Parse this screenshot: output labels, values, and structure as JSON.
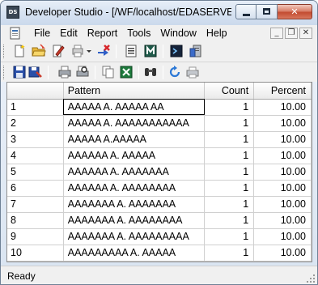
{
  "window": {
    "title": "Developer Studio - [/WF/localhost/EDASERVE:",
    "app_icon_text": "DS"
  },
  "menubar": {
    "items": [
      {
        "label": "File"
      },
      {
        "label": "Edit"
      },
      {
        "label": "Report"
      },
      {
        "label": "Tools"
      },
      {
        "label": "Window"
      },
      {
        "label": "Help"
      }
    ],
    "mdi_buttons": [
      "_",
      "❐",
      "✕"
    ]
  },
  "toolbar1": {
    "icons": [
      "new-document-icon",
      "open-folder-icon",
      "edit-icon",
      "print-setup-icon",
      "dropdown-icon",
      "connect-icon",
      "report-icon",
      "master-file-icon",
      "console-icon",
      "server-icon"
    ]
  },
  "toolbar2": {
    "icons": [
      "save-icon",
      "save-as-icon",
      "print-icon",
      "print-preview-icon",
      "copy-icon",
      "export-excel-icon",
      "find-icon",
      "refresh-icon",
      "print-alt-icon"
    ]
  },
  "grid": {
    "columns": [
      {
        "label": ""
      },
      {
        "label": "Pattern"
      },
      {
        "label": "Count"
      },
      {
        "label": "Percent"
      }
    ],
    "rows": [
      {
        "n": "1",
        "pattern": "AAAAA A. AAAAA AA",
        "count": "1",
        "percent": "10.00"
      },
      {
        "n": "2",
        "pattern": "AAAAA A. AAAAAAAAAAA",
        "count": "1",
        "percent": "10.00"
      },
      {
        "n": "3",
        "pattern": "AAAAA A.AAAAA",
        "count": "1",
        "percent": "10.00"
      },
      {
        "n": "4",
        "pattern": "AAAAAA A. AAAAA",
        "count": "1",
        "percent": "10.00"
      },
      {
        "n": "5",
        "pattern": "AAAAAA A. AAAAAAA",
        "count": "1",
        "percent": "10.00"
      },
      {
        "n": "6",
        "pattern": "AAAAAA A. AAAAAAAA",
        "count": "1",
        "percent": "10.00"
      },
      {
        "n": "7",
        "pattern": "AAAAAAA A. AAAAAAA",
        "count": "1",
        "percent": "10.00"
      },
      {
        "n": "8",
        "pattern": "AAAAAAA A. AAAAAAAA",
        "count": "1",
        "percent": "10.00"
      },
      {
        "n": "9",
        "pattern": "AAAAAAA A. AAAAAAAAA",
        "count": "1",
        "percent": "10.00"
      },
      {
        "n": "10",
        "pattern": "AAAAAAAAA A. AAAAA",
        "count": "1",
        "percent": "10.00"
      }
    ]
  },
  "statusbar": {
    "text": "Ready"
  },
  "colors": {
    "title_gradient_top": "#e7eef8",
    "close_button": "#c34c31",
    "grid_border": "#8d8d8d"
  }
}
